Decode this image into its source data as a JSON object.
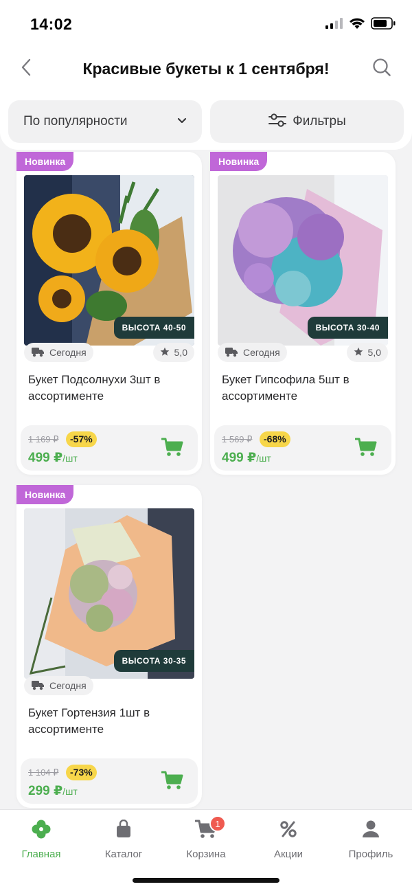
{
  "status": {
    "time": "14:02"
  },
  "header": {
    "title": "Красивые букеты к 1 сентября!",
    "sort_label": "По популярности",
    "filter_label": "Фильтры"
  },
  "products": [
    {
      "badge": "Новинка",
      "height_tag": "ВЫСОТА 40-50",
      "delivery": "Сегодня",
      "rating": "5,0",
      "name": "Букет Подсолнухи 3шт в ассортименте",
      "old_price": "1 169 ₽",
      "discount": "-57%",
      "price": "499 ₽",
      "unit": "/шт"
    },
    {
      "badge": "Новинка",
      "height_tag": "ВЫСОТА 30-40",
      "delivery": "Сегодня",
      "rating": "5,0",
      "name": "Букет Гипсофила 5шт в ассортименте",
      "old_price": "1 569 ₽",
      "discount": "-68%",
      "price": "499 ₽",
      "unit": "/шт"
    },
    {
      "badge": "Новинка",
      "height_tag": "ВЫСОТА 30-35",
      "delivery": "Сегодня",
      "name": "Букет Гортензия 1шт в ассортименте",
      "old_price": "1 104 ₽",
      "discount": "-73%",
      "price": "299 ₽",
      "unit": "/шт"
    }
  ],
  "tabs": [
    {
      "label": "Главная",
      "icon": "clover-icon",
      "active": true
    },
    {
      "label": "Каталог",
      "icon": "bag-icon"
    },
    {
      "label": "Корзина",
      "icon": "cart-icon",
      "count": "1"
    },
    {
      "label": "Акции",
      "icon": "percent-icon"
    },
    {
      "label": "Профиль",
      "icon": "profile-icon"
    }
  ],
  "colors": {
    "accent_green": "#4cae4f",
    "new_badge": "#c067d8",
    "discount_yellow": "#f7d64a",
    "cart_count_red": "#ef5a50"
  }
}
